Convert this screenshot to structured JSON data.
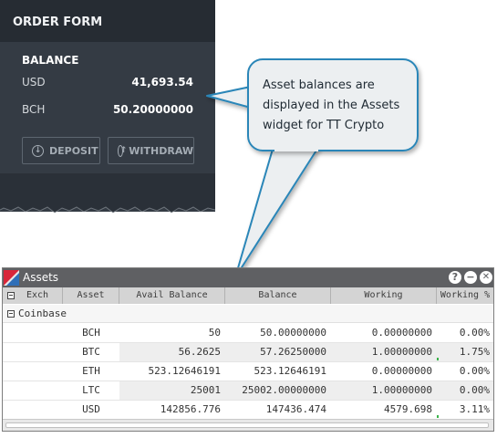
{
  "order_form": {
    "title": "ORDER FORM",
    "balance_title": "BALANCE",
    "balances": [
      {
        "currency": "USD",
        "amount": "41,693.54"
      },
      {
        "currency": "BCH",
        "amount": "50.20000000"
      }
    ],
    "deposit_label": "DEPOSIT",
    "withdraw_label": "WITHDRAW"
  },
  "callout": {
    "lines": [
      "Asset balances are",
      "displayed in the Assets",
      "widget for TT Crypto"
    ]
  },
  "assets": {
    "title": "Assets",
    "controls": {
      "help": "?",
      "minimize": "−",
      "close": "✕"
    },
    "columns": {
      "exch": "Exch",
      "asset": "Asset",
      "avail": "Avail Balance",
      "balance": "Balance",
      "working": "Working",
      "working_pct": "Working %"
    },
    "group": "Coinbase",
    "rows": [
      {
        "asset": "BCH",
        "avail": "50",
        "balance": "50.00000000",
        "working": "0.00000000",
        "pct": "0.00%"
      },
      {
        "asset": "BTC",
        "avail": "56.2625",
        "balance": "57.26250000",
        "working": "1.00000000",
        "pct": "1.75%"
      },
      {
        "asset": "ETH",
        "avail": "523.12646191",
        "balance": "523.12646191",
        "working": "0.00000000",
        "pct": "0.00%"
      },
      {
        "asset": "LTC",
        "avail": "25001",
        "balance": "25002.00000000",
        "working": "1.00000000",
        "pct": "0.00%"
      },
      {
        "asset": "USD",
        "avail": "142856.776",
        "balance": "147436.474",
        "working": "4579.698",
        "pct": "3.11%"
      }
    ]
  },
  "colors": {
    "panel_bg": "#343b44",
    "panel_header": "#262c33",
    "callout_fill": "#eceff1",
    "callout_border": "#2b86b8",
    "titlebar": "#5f6063",
    "working_indicator": "#3ab44a"
  }
}
